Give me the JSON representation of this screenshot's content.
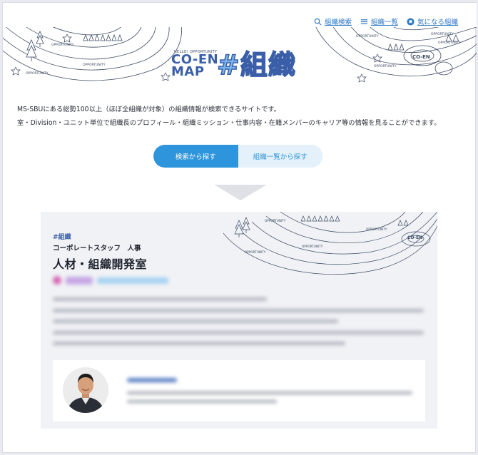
{
  "nav": {
    "items": [
      {
        "label": "組織検索",
        "icon": "search-icon"
      },
      {
        "label": "組織一覧",
        "icon": "list-icon"
      },
      {
        "label": "気になる組織",
        "icon": "bookmark-icon"
      }
    ]
  },
  "logo": {
    "tagline": "HELLO! OPPORTUNITY",
    "line1": "CO-EN",
    "line2": "MAP",
    "mark": "#組織"
  },
  "map_labels": {
    "opportunity": "OPPORTUNITY",
    "coen": "CO-EN"
  },
  "description": {
    "line1": "MS-SBUにある総勢100以上（ほぼ全組織が対象）の組織情報が検索できるサイトです。",
    "line2": "室・Division・ユニット単位で組織長のプロフィール・組織ミッション・仕事内容・在籍メンバーのキャリア等の情報を見ることができます。"
  },
  "tabs": {
    "search": "検索から探す",
    "list": "組織一覧から探す"
  },
  "preview": {
    "logo": "#組織",
    "department": "コーポレートスタッフ　人事",
    "title": "人材・組織開発室"
  },
  "colors": {
    "accent": "#2e94db",
    "brand_blue": "#3a5fa8",
    "link": "#2f78c4"
  }
}
